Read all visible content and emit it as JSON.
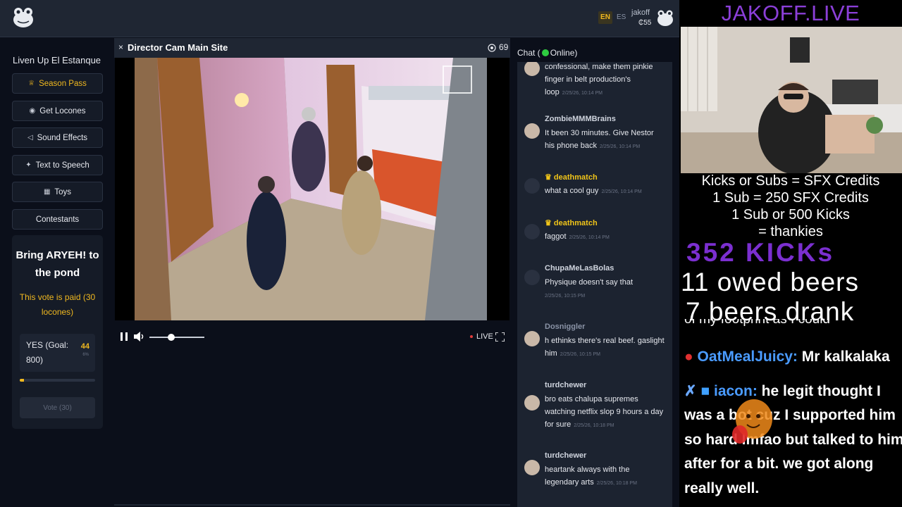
{
  "header": {
    "lang_en": "EN",
    "lang_es": "ES",
    "username": "jakoff",
    "balance": "₵55",
    "accent_color": "#f0b81f"
  },
  "sidebar": {
    "title": "Liven Up El Estanque",
    "items": [
      {
        "label": "Season Pass",
        "icon": "crown-icon"
      },
      {
        "label": "Get Locones",
        "icon": "coin-icon"
      },
      {
        "label": "Sound Effects",
        "icon": "speaker-icon"
      },
      {
        "label": "Text to Speech",
        "icon": "sparkle-icon"
      },
      {
        "label": "Toys",
        "icon": "gift-icon"
      },
      {
        "label": "Contestants",
        "icon": ""
      }
    ],
    "vote": {
      "title": "Bring ARYEH! to the pond",
      "paid_note": "This vote is paid (30 locones)",
      "option_label": "YES (Goal: 800)",
      "count": "44",
      "percent": "6%",
      "progress": 0.06,
      "button_label": "Vote (30)"
    }
  },
  "player": {
    "close": "×",
    "title": "Director Cam Main Site",
    "viewers": "69",
    "live_label": "LIVE",
    "volume_level": 0.4
  },
  "chat": {
    "header_prefix": "Chat (",
    "header_suffix": " Online)",
    "messages": [
      {
        "name": "",
        "text": "confessional, make them pinkie finger in belt production's loop",
        "time": "2/25/26, 10:14 PM",
        "vip": false,
        "avatar": "generic"
      },
      {
        "name": "ZombieMMMBrains",
        "text": "It been 30 minutes. Give Nestor his phone back",
        "time": "2/25/26, 10:14 PM",
        "vip": false,
        "avatar": "person"
      },
      {
        "name": "deathmatch",
        "text": "what a cool guy",
        "time": "2/25/26, 10:14 PM",
        "vip": true,
        "avatar": "frog"
      },
      {
        "name": "deathmatch",
        "text": "faggot",
        "time": "2/25/26, 10:14 PM",
        "vip": true,
        "avatar": "frog"
      },
      {
        "name": "ChupaMeLasBolas",
        "text": "Physique doesn't say that",
        "time": "2/25/26, 10:15 PM",
        "vip": false,
        "avatar": "frog"
      },
      {
        "name": "Dosniggler",
        "text": "h ethinks there's real beef. gaslight him",
        "time": "2/25/26, 10:15 PM",
        "vip": false,
        "avatar": "person"
      },
      {
        "name": "turdchewer",
        "text": "bro eats chalupa supremes watching netflix slop 9 hours a day for sure",
        "time": "2/25/26, 10:18 PM",
        "vip": false,
        "avatar": "person"
      },
      {
        "name": "turdchewer",
        "text": "heartank always with the legendary arts",
        "time": "2/25/26, 10:18 PM",
        "vip": false,
        "avatar": "person"
      }
    ]
  },
  "overlay": {
    "brand": "JAKOFF.LIVE",
    "info_lines": [
      "Kicks or Subs = SFX Credits",
      "1 Sub = 250 SFX Credits",
      "1 Sub or 500 Kicks",
      "= thankies"
    ],
    "kicks": "352 KICKs",
    "owed_beers": "11 owed beers",
    "beers_drank": "7 beers drank",
    "cut_text": "of my footprint as I could",
    "chat": [
      {
        "user": "OatMealJuicy:",
        "text": " Mr kalkalaka"
      },
      {
        "user": "iacon:",
        "text": " he legit thought I"
      }
    ],
    "chat_wrap": [
      "was a bot cuz I supported him",
      "so hard lmfao but talked to him",
      "after for a bit. we got along",
      "really well."
    ]
  }
}
